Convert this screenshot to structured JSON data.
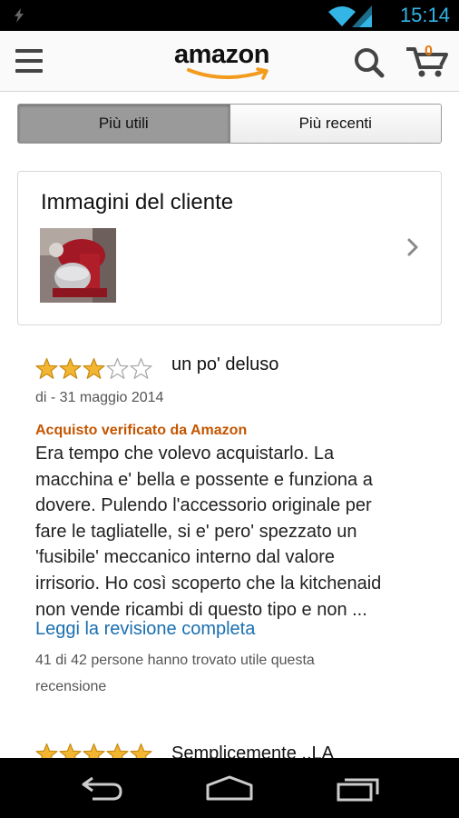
{
  "status_bar": {
    "time": "15:14"
  },
  "header": {
    "logo_text": "amazon",
    "cart_count": "0"
  },
  "tabs": [
    {
      "label": "Più utili",
      "active": true
    },
    {
      "label": "Più recenti",
      "active": false
    }
  ],
  "customer_images": {
    "title": "Immagini del cliente"
  },
  "reviews": [
    {
      "rating": 3,
      "max_rating": 5,
      "headline": "un po' deluso",
      "byline": "di - 31 maggio 2014",
      "verified_label": "Acquisto verificato da Amazon",
      "body_lines": [
        "Era tempo che volevo acquistarlo. La",
        "macchina e' bella e possente e funziona a",
        "dovere. Pulendo l'accessorio originale per",
        "fare le tagliatelle, si e' pero' spezzato un",
        "'fusibile' meccanico interno dal valore",
        "irrisorio. Ho così scoperto che la kitchenaid",
        "non vende ricambi di questo tipo e non ..."
      ],
      "read_more": "Leggi la revisione completa",
      "helpful_lines": [
        "41 di 42 persone hanno trovato utile questa",
        "recensione"
      ]
    },
    {
      "rating": 5,
      "max_rating": 5,
      "headline": "Semplicemente ..LA"
    }
  ],
  "colors": {
    "accent_time": "#33b5e5",
    "star": "#f3b632",
    "verified": "#c45500",
    "link": "#1a6fb0",
    "cart_count": "#e47911"
  }
}
